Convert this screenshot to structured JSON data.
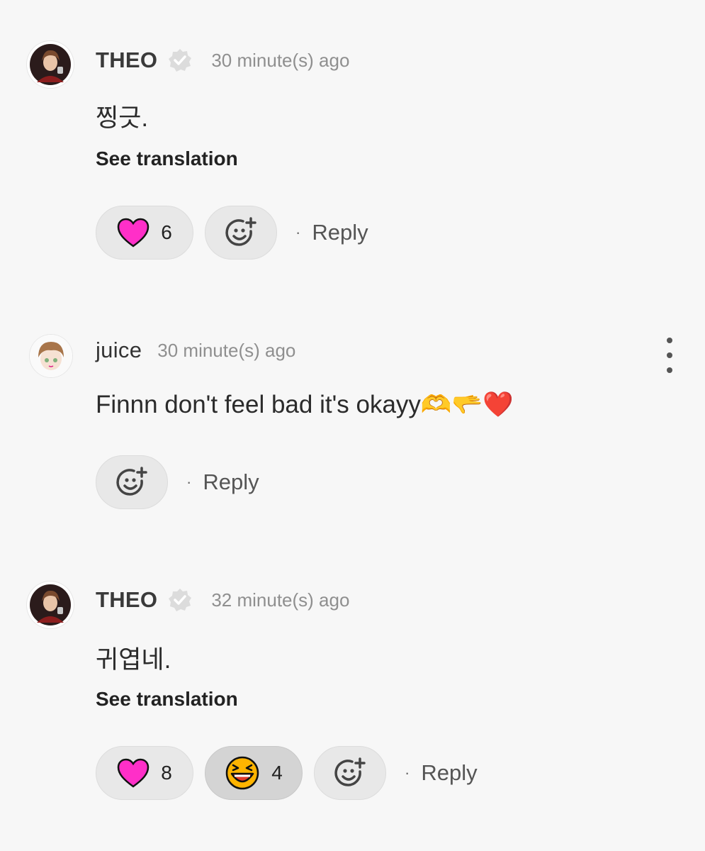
{
  "comments": [
    {
      "username": "THEO",
      "verified": true,
      "time": "30 minute(s) ago",
      "text": "찡긋.",
      "see_translation": "See translation",
      "reactions": [
        {
          "icon": "heart-icon",
          "count": "6"
        }
      ],
      "reply_label": "Reply"
    },
    {
      "username": "juice",
      "verified": false,
      "time": "30 minute(s) ago",
      "text": "Finnn don't feel bad it's okayy🫶🫳❤️",
      "reactions": [],
      "reply_label": "Reply"
    },
    {
      "username": "THEO",
      "verified": true,
      "time": "32 minute(s) ago",
      "text": "귀엽네.",
      "see_translation": "See translation",
      "reactions": [
        {
          "icon": "heart-icon",
          "count": "8"
        },
        {
          "icon": "laughing-face-icon",
          "count": "4"
        }
      ],
      "reply_label": "Reply"
    }
  ],
  "separator": "·",
  "colors": {
    "background": "#f7f7f7",
    "heart": "#ff2fc8",
    "pill": "#e8e8e8",
    "pill_active": "#d4d4d4",
    "time": "#8f8f8f"
  }
}
